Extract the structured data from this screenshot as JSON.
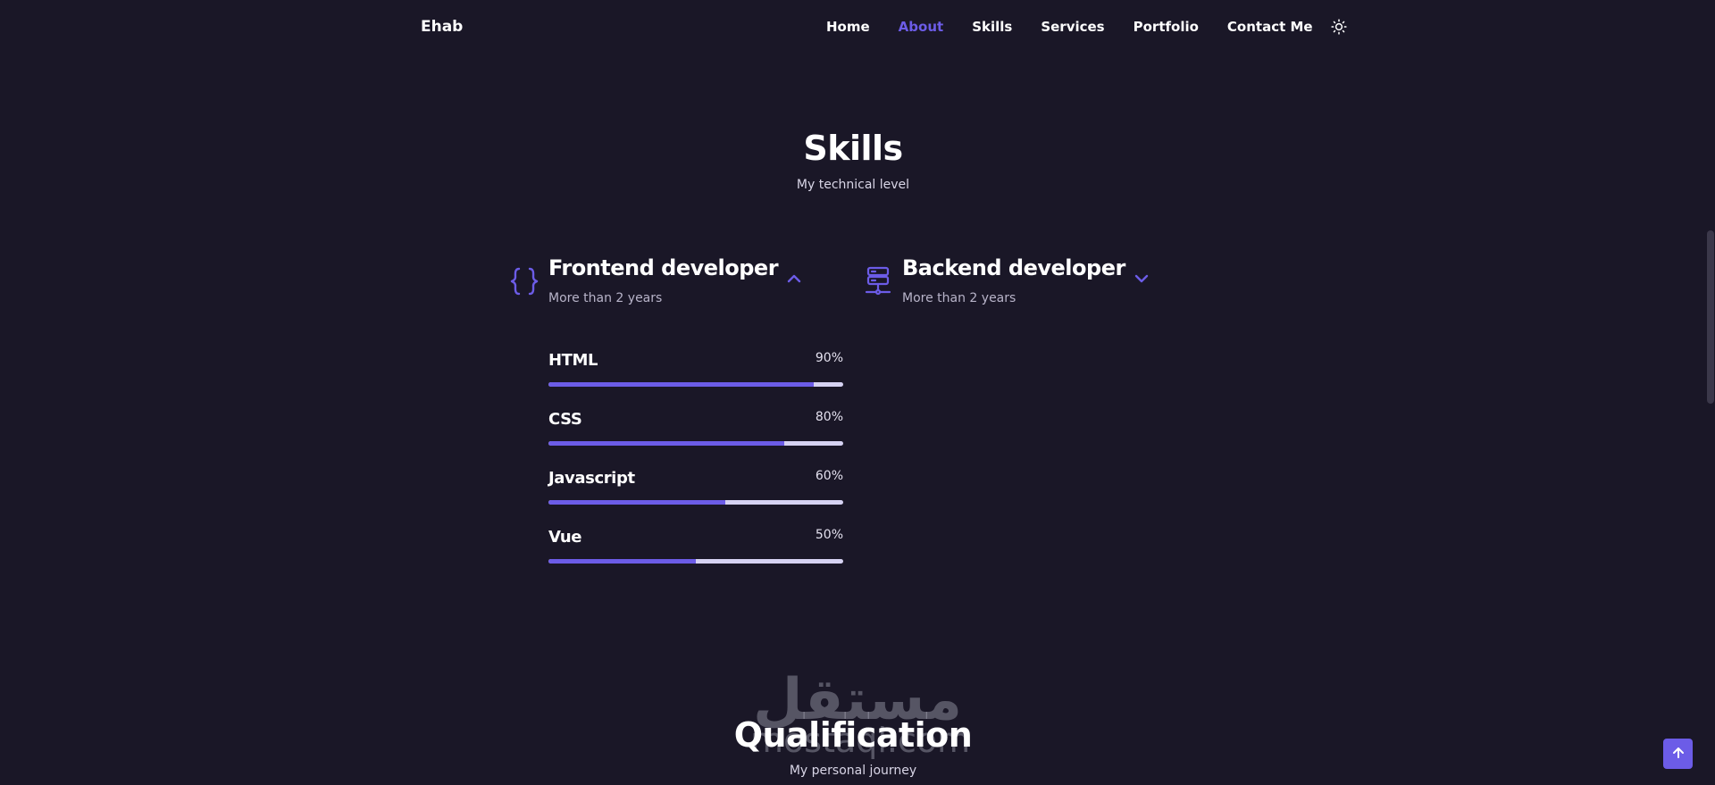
{
  "header": {
    "logo": "Ehab",
    "nav": [
      {
        "label": "Home"
      },
      {
        "label": "About"
      },
      {
        "label": "Skills"
      },
      {
        "label": "Services"
      },
      {
        "label": "Portfolio"
      },
      {
        "label": "Contact Me"
      }
    ],
    "active_nav": "About",
    "theme_icon": "sun-icon"
  },
  "skills_section": {
    "title": "Skills",
    "subtitle": "My technical level",
    "groups": [
      {
        "title": "Frontend developer",
        "years": "More than 2 years",
        "icon": "code-braces-icon",
        "arrow_icon": "chevron-up-icon",
        "expanded": true,
        "skills": [
          {
            "name": "HTML",
            "percent_label": "90%",
            "level": 90
          },
          {
            "name": "CSS",
            "percent_label": "80%",
            "level": 80
          },
          {
            "name": "Javascript",
            "percent_label": "60%",
            "level": 60
          },
          {
            "name": "Vue",
            "percent_label": "50%",
            "level": 50
          }
        ]
      },
      {
        "title": "Backend developer",
        "years": "More than 2 years",
        "icon": "server-icon",
        "arrow_icon": "chevron-down-icon",
        "expanded": false
      }
    ]
  },
  "qualification_section": {
    "title": "Qualification",
    "subtitle": "My personal journey"
  },
  "watermark": {
    "arabic": "مستقل",
    "latin": "mostaql.com"
  },
  "scrollup_icon": "arrow-up-icon",
  "colors": {
    "background": "#1a1727",
    "accent": "#6c5ce7",
    "track": "#d6d2f2",
    "text": "#ffffff"
  }
}
